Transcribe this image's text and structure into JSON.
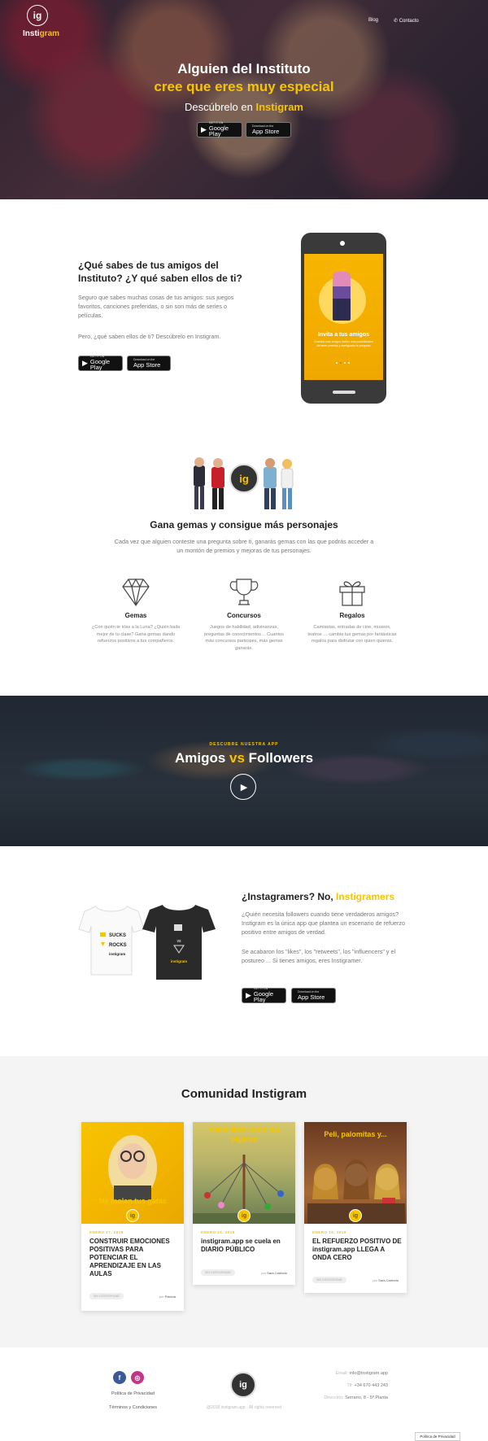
{
  "header": {
    "logo_mark": "ig",
    "logo_part1": "Insti",
    "logo_part2": "gram",
    "nav": [
      "Blog",
      "Contacto"
    ]
  },
  "hero": {
    "line1": "Alguien del Instituto",
    "line2": "cree que eres muy especial",
    "line3_pre": "Descúbrelo en ",
    "line3_brand": "Instigram"
  },
  "stores": {
    "google_small": "GET IT ON",
    "google_big": "Google Play",
    "apple_small": "Download on the",
    "apple_big": "App Store"
  },
  "about": {
    "title": "¿Qué sabes de tus amigos del Instituto? ¿Y qué saben ellos de ti?",
    "p1": "Seguro que sabes muchas cosas de tus amigos: sus juegos favoritos, canciones preferidas, o sin son más de series o películas.",
    "p2": "Pero, ¿qué saben ellos de ti? Descúbrelo en Instigram.",
    "phone_title": "Invita a tus amigos",
    "phone_sub": "Cuantos más amigos invites más posibilidades de tener premios y averiguarlo te pregunta"
  },
  "gems": {
    "title": "Gana gemas y consigue más personajes",
    "text": "Cada vez que alguien conteste una pregunta sobre ti, ganarás gemas con las que podrás acceder a un montón de premios y mejoras de tus personajes.",
    "features": [
      {
        "icon": "diamond-icon",
        "title": "Gemas",
        "text": "¿Con quién te irías a la Luna? ¿Quién baila mejor de tu clase? Gana gemas dando refuerzos positivos a tus compañeros."
      },
      {
        "icon": "trophy-icon",
        "title": "Concursos",
        "text": "Juegos de habilidad, adivinanzas, preguntas de conocimientos… Cuantos más concursos participes, más gemas ganarás."
      },
      {
        "icon": "gift-icon",
        "title": "Regalos",
        "text": "Camisetas, entradas de cine, museos, teatros … cambia tus gemas por fantásticas regalos para disfrutar con quien quieras."
      }
    ]
  },
  "video": {
    "kicker": "DESCUBRE NUESTRA APP",
    "title_a": "Amigos ",
    "title_vs": "vs",
    "title_b": " Followers"
  },
  "instagramers": {
    "title_a": "¿Instagramers? No, ",
    "title_b": "Instigramers",
    "p1": "¿Quién necesita followers cuando tiene verdaderos amigos? Instigram es la única app que plantea un escenario de refuerzo positivo entre amigos de verdad.",
    "p2": "Se acabaron los \"likes\", los \"retweets\", los \"influencers\" y el postureo ... Si tienes amigos, eres Instigramer.",
    "shirt_white_lines": [
      "SUCKS",
      "ROCKS",
      "instigram"
    ],
    "shirt_black_lines": [
      "vs",
      "instigram"
    ]
  },
  "community": {
    "title": "Comunidad Instigram",
    "coin": "ig",
    "posts": [
      {
        "caption": "Me molan tus gafas",
        "date": "ENERO 27, 2019",
        "title": "CONSTRUIR EMOCIONES POSITIVAS PARA POTENCIAR EL APRENDIZAJE EN LAS AULAS",
        "tag": "SIN CATEGORIZAR",
        "by": "por",
        "author": "Patricia"
      },
      {
        "caption": "Vuela libre como los pájaros",
        "date": "ENERO 16, 2019",
        "title": "instigram.app se cuela en DIARIO PÚBLICO",
        "tag": "SIN CATEGORIZAR",
        "by": "por",
        "author": "Sara Carriedo"
      },
      {
        "caption": "Peli, palomitas y...",
        "date": "ENERO 16, 2019",
        "title": "EL REFUERZO POSITIVO DE instigram.app LLEGA A ONDA CERO",
        "tag": "SIN CATEGORIZAR",
        "by": "por",
        "author": "Sara Carriedo"
      }
    ]
  },
  "footer": {
    "facebook": "f",
    "instagram": "◎",
    "privacy": "Política de Privacidad",
    "terms": "Términos y Condiciones",
    "logo_mark": "ig",
    "copyright": "@2018 instigram.app - All rights reserved",
    "email_label": "Email: ",
    "email": "info@instigram.app",
    "tel_label": "Tlf: ",
    "tel": "+34 670 443 243",
    "address_label": "Dirección: ",
    "address": "Serrano, 8 - 5ª Planta",
    "privacy_button": "Política de Privacidad"
  },
  "colors": {
    "accent": "#f6c500",
    "dark": "#222222",
    "facebook": "#3b5998",
    "instagram": "#c13584"
  }
}
